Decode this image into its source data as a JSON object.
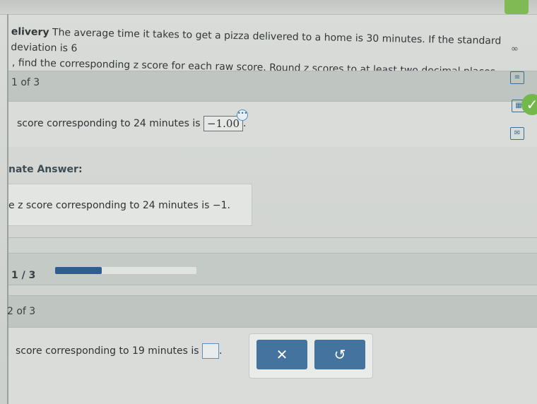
{
  "problem": {
    "heading": "elivery",
    "line1": "The average time it takes to get a pizza delivered to a home is 30 minutes. If the standard deviation is 6",
    "line2": ", find the corresponding z score for each raw score. Round z scores to at least two decimal places.",
    "infinity_glyph": "∞"
  },
  "part1": {
    "label": "1 of 3",
    "question_text": "score corresponding to 24 minutes is",
    "answer_value": "−1.00",
    "answer_suffix": ".",
    "dots_glyph": "•••"
  },
  "alternate": {
    "title": "nate Answer:",
    "text": "e z score corresponding to 24 minutes is −1."
  },
  "progress": {
    "label": "1 / 3",
    "fraction": 0.33
  },
  "part2": {
    "label": "2 of 3",
    "question_text": "score corresponding to 19 minutes is",
    "answer_suffix": "."
  },
  "actions": {
    "clear_glyph": "✕",
    "undo_glyph": "↺"
  },
  "side_icons": {
    "doc": "≡",
    "calc": "▦",
    "mail": "✉",
    "check": "✓"
  },
  "colors": {
    "accent_blue": "#44739f",
    "progress_blue": "#2e5c93",
    "success_green": "#72b84a"
  }
}
